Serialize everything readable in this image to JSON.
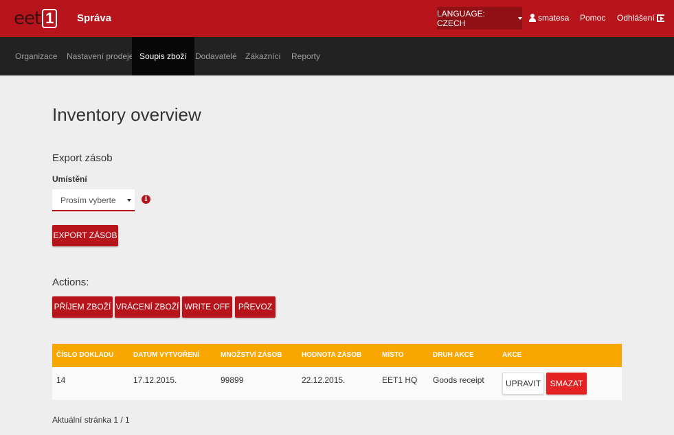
{
  "header": {
    "logo_text": "eet",
    "logo_box": "1",
    "app_title": "Správa",
    "language_label": "LANGUAGE: CZECH",
    "user_name": "smatesa",
    "help_label": "Pomoc",
    "logout_label": "Odhlášení"
  },
  "nav": {
    "items": [
      {
        "label": "Organizace"
      },
      {
        "label": "Nastavení prodeje"
      },
      {
        "label": "Soupis zboží"
      },
      {
        "label": "Dodavatelé"
      },
      {
        "label": "Zákazníci"
      },
      {
        "label": "Reporty"
      }
    ],
    "active_index": 2
  },
  "main": {
    "title": "Inventory overview",
    "export_section": {
      "title": "Export zásob",
      "location_label": "Umístění",
      "select_value": "Prosím vyberte",
      "info_glyph": "i",
      "export_button": "EXPORT ZÁSOB"
    },
    "actions": {
      "label": "Actions:",
      "buttons": [
        {
          "label": "PŘÍJEM ZBOŽÍ"
        },
        {
          "label": "VRÁCENÍ ZBOŽÍ"
        },
        {
          "label": "WRITE OFF"
        },
        {
          "label": "PŘEVOZ"
        }
      ]
    },
    "table": {
      "columns": [
        "ČÍSLO DOKLADU",
        "DATUM VYTVOŘENÍ",
        "MNOŽSTVÍ ZÁSOB",
        "HODNOTA ZÁSOB",
        "MÍSTO",
        "DRUH AKCE",
        "AKCE"
      ],
      "rows": [
        {
          "number": "14",
          "created": "17.12.2015.",
          "quantity": "99899",
          "value": "22.12.2015.",
          "place": "EET1 HQ",
          "action_type": "Goods receipt",
          "edit_label": "UPRAVIT",
          "delete_label": "SMAZAT"
        }
      ]
    },
    "pager": "Aktuální stránka 1 / 1"
  },
  "colors": {
    "brand_red": "#b8141b",
    "nav_dark": "#222222",
    "table_header": "#f9a600",
    "delete_red": "#e52121"
  }
}
